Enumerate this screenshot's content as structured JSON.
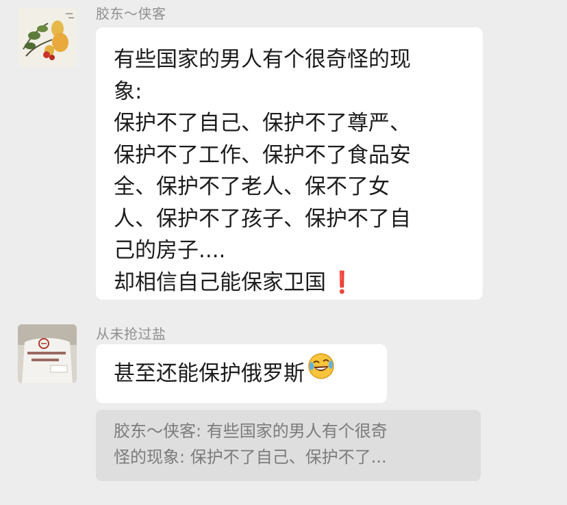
{
  "messages": [
    {
      "sender": "胶东～侠客",
      "text_lines": [
        "有些国家的男人有个很奇怪的现",
        "象:",
        "保护不了自己、保护不了尊严、",
        "保护不了工作、保护不了食品安",
        "全、保护不了老人、保不了女",
        "人、保护不了孩子、保护不了自",
        "己的房子....",
        "却相信自己能保家卫国"
      ],
      "trailing_mark": "❗",
      "avatar_icon": "flower-painting-avatar"
    },
    {
      "sender": "从未抢过盐",
      "text": "甚至还能保护俄罗斯",
      "emoji_icon": "laughing-crying-face-emoji",
      "avatar_icon": "white-shirt-logo-avatar",
      "quote_lines": [
        "胶东～侠客: 有些国家的男人有个很奇",
        "怪的现象: 保护不了自己、保护不了..."
      ]
    }
  ],
  "colors": {
    "background": "#ededed",
    "bubble": "#ffffff",
    "quote_background": "#dedede",
    "sender_name": "#8f8f8f",
    "exclamation": "#e02424"
  }
}
